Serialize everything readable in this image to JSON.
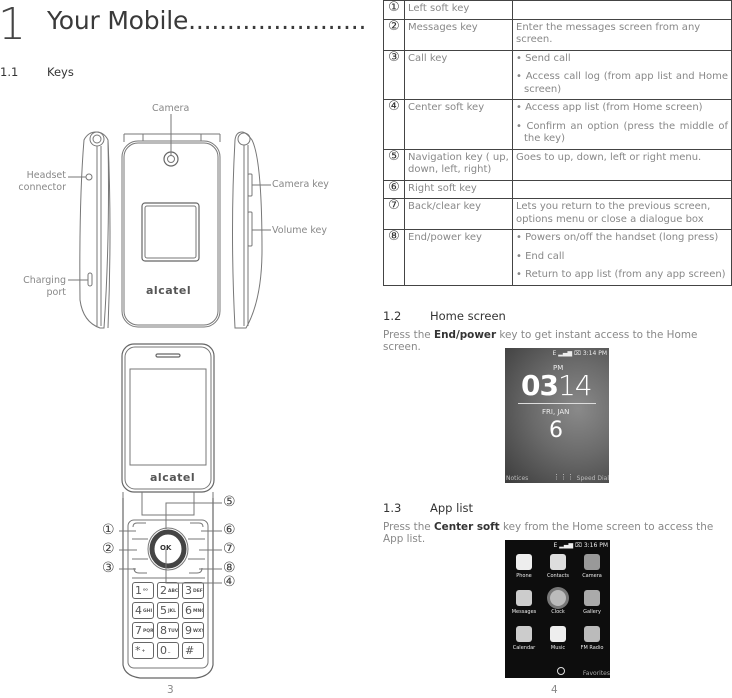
{
  "left_page": {
    "chapter_number": "1",
    "chapter_title": "Your Mobile.......................",
    "section": {
      "number": "1.1",
      "title": "Keys"
    },
    "closed_phone_labels": {
      "camera": "Camera",
      "headset_connector_line1": "Headset",
      "headset_connector_line2": "connector",
      "charging_port_line1": "Charging",
      "charging_port_line2": "port",
      "camera_key": "Camera key",
      "volume_key": "Volume key"
    },
    "open_phone_callouts": [
      "①",
      "②",
      "③",
      "④",
      "⑤",
      "⑥",
      "⑦",
      "⑧"
    ],
    "keypad": {
      "ok": "OK",
      "keys": [
        {
          "digit": "1",
          "letters": "ᴼᴼ"
        },
        {
          "digit": "2",
          "letters": "ABC"
        },
        {
          "digit": "3",
          "letters": "DEF"
        },
        {
          "digit": "4",
          "letters": "GHI"
        },
        {
          "digit": "5",
          "letters": "JKL"
        },
        {
          "digit": "6",
          "letters": "MNO"
        },
        {
          "digit": "7",
          "letters": "PQRS"
        },
        {
          "digit": "8",
          "letters": "TUV"
        },
        {
          "digit": "9",
          "letters": "WXYZ"
        },
        {
          "digit": "*",
          "letters": "+"
        },
        {
          "digit": "0",
          "letters": "_"
        },
        {
          "digit": "#",
          "letters": ""
        }
      ]
    },
    "brand": "alcatel",
    "page_number": "3"
  },
  "right_page": {
    "key_table": [
      {
        "num": "①",
        "name": "Left soft key",
        "desc": []
      },
      {
        "num": "②",
        "name": "Messages key",
        "desc": [
          "Enter the messages screen from any screen."
        ],
        "plain": true
      },
      {
        "num": "③",
        "name": "Call key",
        "desc": [
          "Send call",
          "Access call log (from app list and Home screen)"
        ]
      },
      {
        "num": "④",
        "name": "Center soft key",
        "desc": [
          "Access app list (from Home screen)",
          "Confirm an option (press the middle of the key)"
        ]
      },
      {
        "num": "⑤",
        "name": "Navigation key ( up, down, left, right)",
        "desc": [
          "Goes to up, down, left or right menu."
        ],
        "plain": true
      },
      {
        "num": "⑥",
        "name": "Right soft key",
        "desc": []
      },
      {
        "num": "⑦",
        "name": "Back/clear key",
        "desc": [
          "Lets you return to the previous screen, options menu or close a dialogue box"
        ],
        "plain": true
      },
      {
        "num": "⑧",
        "name": "End/power key",
        "desc": [
          "Powers on/off the handset (long press)",
          "End call",
          "Return to app list (from any app screen)"
        ]
      }
    ],
    "home_section": {
      "number": "1.2",
      "title": "Home screen",
      "text_before": "Press the ",
      "bold": "End/power",
      "text_after": " key to get instant access to the Home screen."
    },
    "home_screen": {
      "status": "E ▂▄▆ ⌧ 3:14 PM",
      "ampm": "PM",
      "hour": "03",
      "minute": "14",
      "date": "FRI, JAN",
      "day": "6",
      "left_soft": "Notices",
      "right_soft": "Speed Dial"
    },
    "applist_section": {
      "number": "1.3",
      "title": "App list",
      "text_before": "Press the ",
      "bold": "Center soft",
      "text_after": " key from the Home screen to access the App list."
    },
    "app_screen": {
      "status": "E ▂▄▆ ⌧ 3:16 PM",
      "apps": [
        "Phone",
        "Contacts",
        "Camera",
        "Messages",
        "Clock",
        "Gallery",
        "Calendar",
        "Music",
        "FM Radio"
      ],
      "right_soft": "Favorites"
    },
    "page_number": "4"
  }
}
